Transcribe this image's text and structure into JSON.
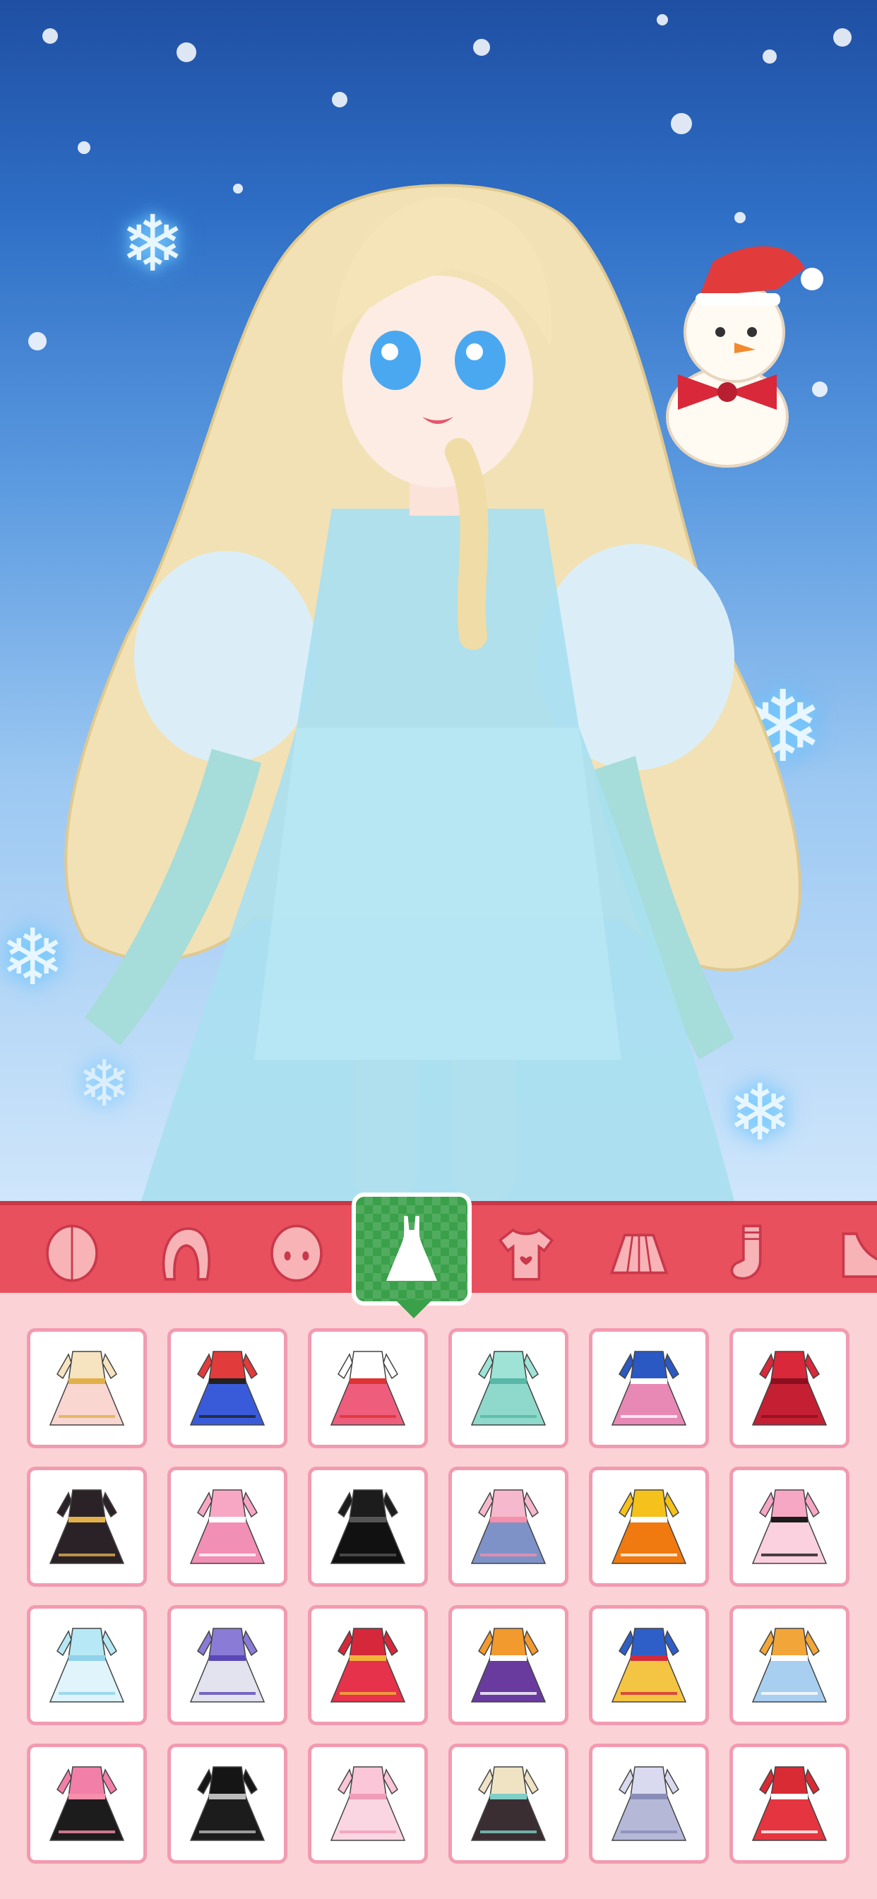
{
  "scene": {
    "character": "anime-girl-ice-dress",
    "companion": "snowman-with-santa-hat"
  },
  "categories": [
    {
      "id": "skin",
      "icon": "face-skin-icon"
    },
    {
      "id": "hair",
      "icon": "hair-icon"
    },
    {
      "id": "face",
      "icon": "face-icon"
    },
    {
      "id": "dress",
      "icon": "dress-icon",
      "selected": true
    },
    {
      "id": "top",
      "icon": "tshirt-icon"
    },
    {
      "id": "skirt",
      "icon": "skirt-icon"
    },
    {
      "id": "socks",
      "icon": "socks-icon"
    },
    {
      "id": "shoes",
      "icon": "shoe-icon"
    }
  ],
  "colors": {
    "category_bar": "#e9505e",
    "selected_tab": "#3aa04a",
    "panel_bg": "#fbd3d6",
    "tile_border": "#f29bb0"
  },
  "outfits": [
    {
      "name": "outfit-gold-fairy-tutu",
      "top": "#f6e3c0",
      "bottom": "#f9d6d0",
      "accent": "#e2b04a"
    },
    {
      "name": "outfit-jacket-shorts",
      "top": "#e23b3b",
      "bottom": "#3a5bd9",
      "accent": "#222"
    },
    {
      "name": "outfit-white-blouse-pink-skirt",
      "top": "#ffffff",
      "bottom": "#ef5d7c",
      "accent": "#d33"
    },
    {
      "name": "outfit-mint-gown",
      "top": "#9fe3d6",
      "bottom": "#8fd9cc",
      "accent": "#58b7a6"
    },
    {
      "name": "outfit-blue-vest-plaid",
      "top": "#2b59c3",
      "bottom": "#e889b5",
      "accent": "#fff"
    },
    {
      "name": "outfit-red-ruffle-dress",
      "top": "#d8283a",
      "bottom": "#c51f33",
      "accent": "#8a1020"
    },
    {
      "name": "outfit-black-gold-coat",
      "top": "#2a2226",
      "bottom": "#2a2226",
      "accent": "#e2b04a"
    },
    {
      "name": "outfit-pink-gingham",
      "top": "#f7a7c4",
      "bottom": "#f28fb5",
      "accent": "#ffffff"
    },
    {
      "name": "outfit-black-lace",
      "top": "#1c1c1c",
      "bottom": "#111111",
      "accent": "#555"
    },
    {
      "name": "outfit-pink-cardigan-denim",
      "top": "#f6b8cc",
      "bottom": "#7e92c8",
      "accent": "#f58fab"
    },
    {
      "name": "outfit-orange-pinafore",
      "top": "#f5c11b",
      "bottom": "#f07a10",
      "accent": "#fff"
    },
    {
      "name": "outfit-pink-bow-ruffle",
      "top": "#f6a7c3",
      "bottom": "#fbd0df",
      "accent": "#1c1c1c"
    },
    {
      "name": "outfit-ice-fairy",
      "top": "#b7e8f5",
      "bottom": "#dff4fb",
      "accent": "#8fd2ea"
    },
    {
      "name": "outfit-purple-sporty",
      "top": "#8a7bd6",
      "bottom": "#e3e3ef",
      "accent": "#5a48b8"
    },
    {
      "name": "outfit-red-gold-ballgown",
      "top": "#d6283b",
      "bottom": "#e6324a",
      "accent": "#f2b33a"
    },
    {
      "name": "outfit-orange-purple-gown",
      "top": "#f29a2e",
      "bottom": "#6a3b9e",
      "accent": "#ffffff"
    },
    {
      "name": "outfit-blue-yellow-idol",
      "top": "#2e5fc8",
      "bottom": "#f4c542",
      "accent": "#d32b3c"
    },
    {
      "name": "outfit-blue-layered-gown",
      "top": "#f2a63a",
      "bottom": "#a9cff0",
      "accent": "#ffffff"
    },
    {
      "name": "outfit-pink-top-black-skirt",
      "top": "#f27fa8",
      "bottom": "#1c1c1c",
      "accent": "#f58fab"
    },
    {
      "name": "outfit-black-leather",
      "top": "#151515",
      "bottom": "#1c1c1c",
      "accent": "#bbb"
    },
    {
      "name": "outfit-pink-rose-gown",
      "top": "#fbc6d8",
      "bottom": "#fad5e2",
      "accent": "#f09cb8"
    },
    {
      "name": "outfit-cream-black-cape",
      "top": "#efe3c4",
      "bottom": "#3a2e33",
      "accent": "#7fcfc7"
    },
    {
      "name": "outfit-silver-dress",
      "top": "#d9d9ef",
      "bottom": "#b6b8d8",
      "accent": "#8a8cb8"
    },
    {
      "name": "outfit-red-ballerina",
      "top": "#d92b34",
      "bottom": "#e43540",
      "accent": "#ffffff"
    }
  ]
}
